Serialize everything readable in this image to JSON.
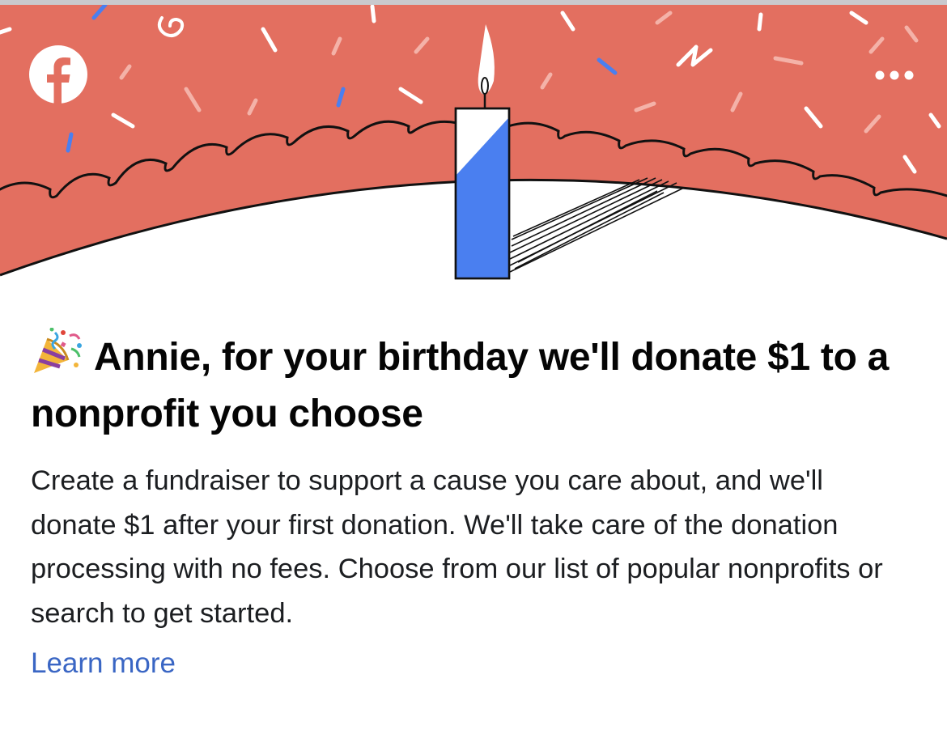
{
  "header": {
    "logo_icon": "facebook-logo-icon",
    "more_icon": "more-options-icon",
    "brand_color": "#e36f60",
    "candle_color": "#4a7ff0"
  },
  "card": {
    "emoji": "🎉",
    "title": "Annie, for your birthday we'll donate $1 to a nonprofit you choose",
    "description": "Create a fundraiser to support a cause you care about, and we'll donate $1 after your first donation. We'll take care of the donation processing with no fees. Choose from our list of popular nonprofits or search to get started.",
    "learn_more": "Learn more",
    "link_color": "#3a66c4"
  }
}
